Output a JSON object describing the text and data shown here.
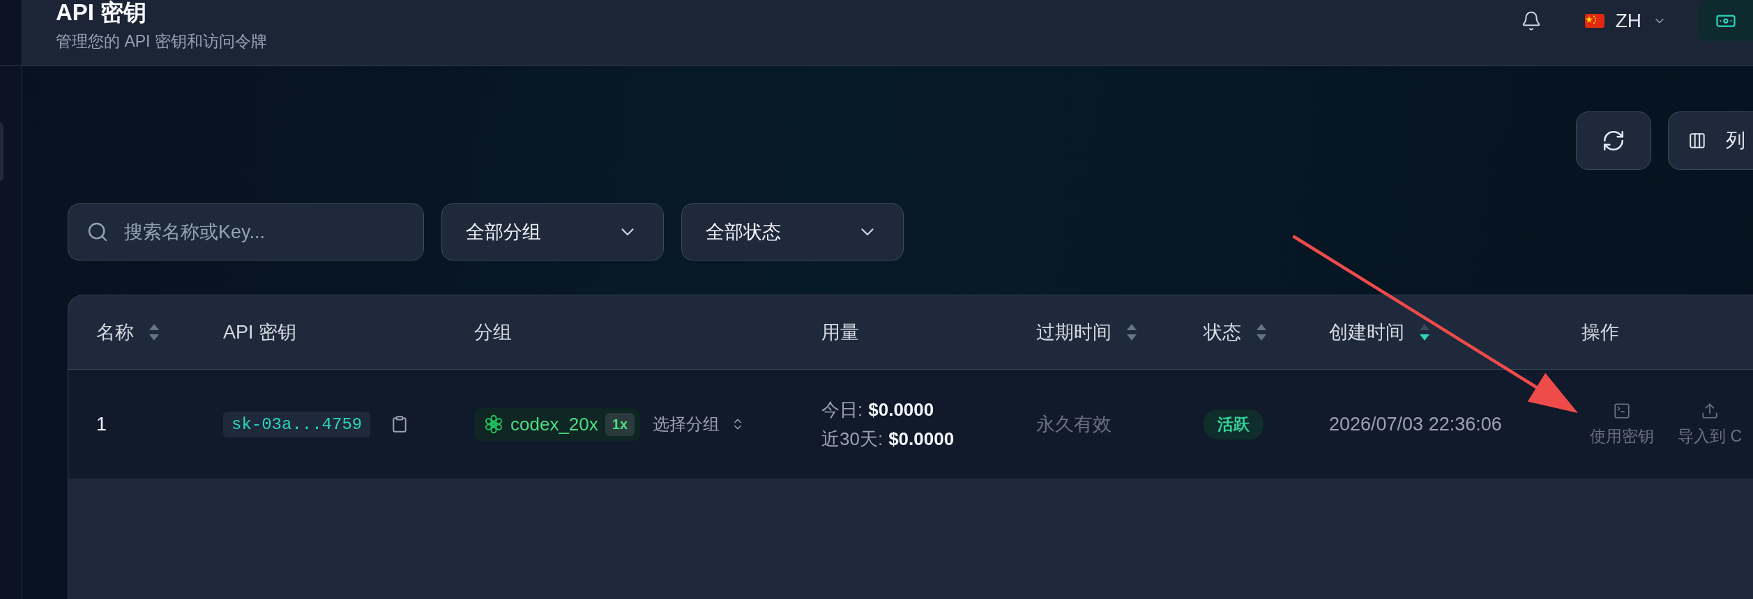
{
  "header": {
    "title": "API 密钥",
    "subtitle": "管理您的 API 密钥和访问令牌",
    "language": {
      "code": "ZH"
    }
  },
  "toolbar": {
    "columns_button": {
      "label": "列"
    }
  },
  "filters": {
    "search": {
      "placeholder": "搜索名称或Key..."
    },
    "group": {
      "value": "全部分组"
    },
    "status": {
      "value": "全部状态"
    }
  },
  "table": {
    "columns": [
      {
        "label": "名称",
        "sortable": true,
        "sorted": false
      },
      {
        "label": "API 密钥",
        "sortable": false
      },
      {
        "label": "分组",
        "sortable": false
      },
      {
        "label": "用量",
        "sortable": false
      },
      {
        "label": "过期时间",
        "sortable": true,
        "sorted": false
      },
      {
        "label": "状态",
        "sortable": true,
        "sorted": false
      },
      {
        "label": "创建时间",
        "sortable": true,
        "sorted": true
      },
      {
        "label": "操作",
        "sortable": false
      }
    ],
    "rows": [
      {
        "name": "1",
        "key": "sk-03a...4759",
        "group": {
          "name": "codex_20x",
          "multiplier": "1x",
          "select_label": "选择分组"
        },
        "usage": [
          {
            "label": "今日:",
            "value": "$0.0000"
          },
          {
            "label": "近30天:",
            "value": "$0.0000"
          }
        ],
        "expiry": "永久有效",
        "status": {
          "label": "活跃",
          "kind": "active"
        },
        "created": "2026/07/03 22:36:06",
        "actions": [
          {
            "label": "使用密钥",
            "kind": "terminal"
          },
          {
            "label": "导入到 C",
            "kind": "upload"
          }
        ]
      }
    ]
  }
}
